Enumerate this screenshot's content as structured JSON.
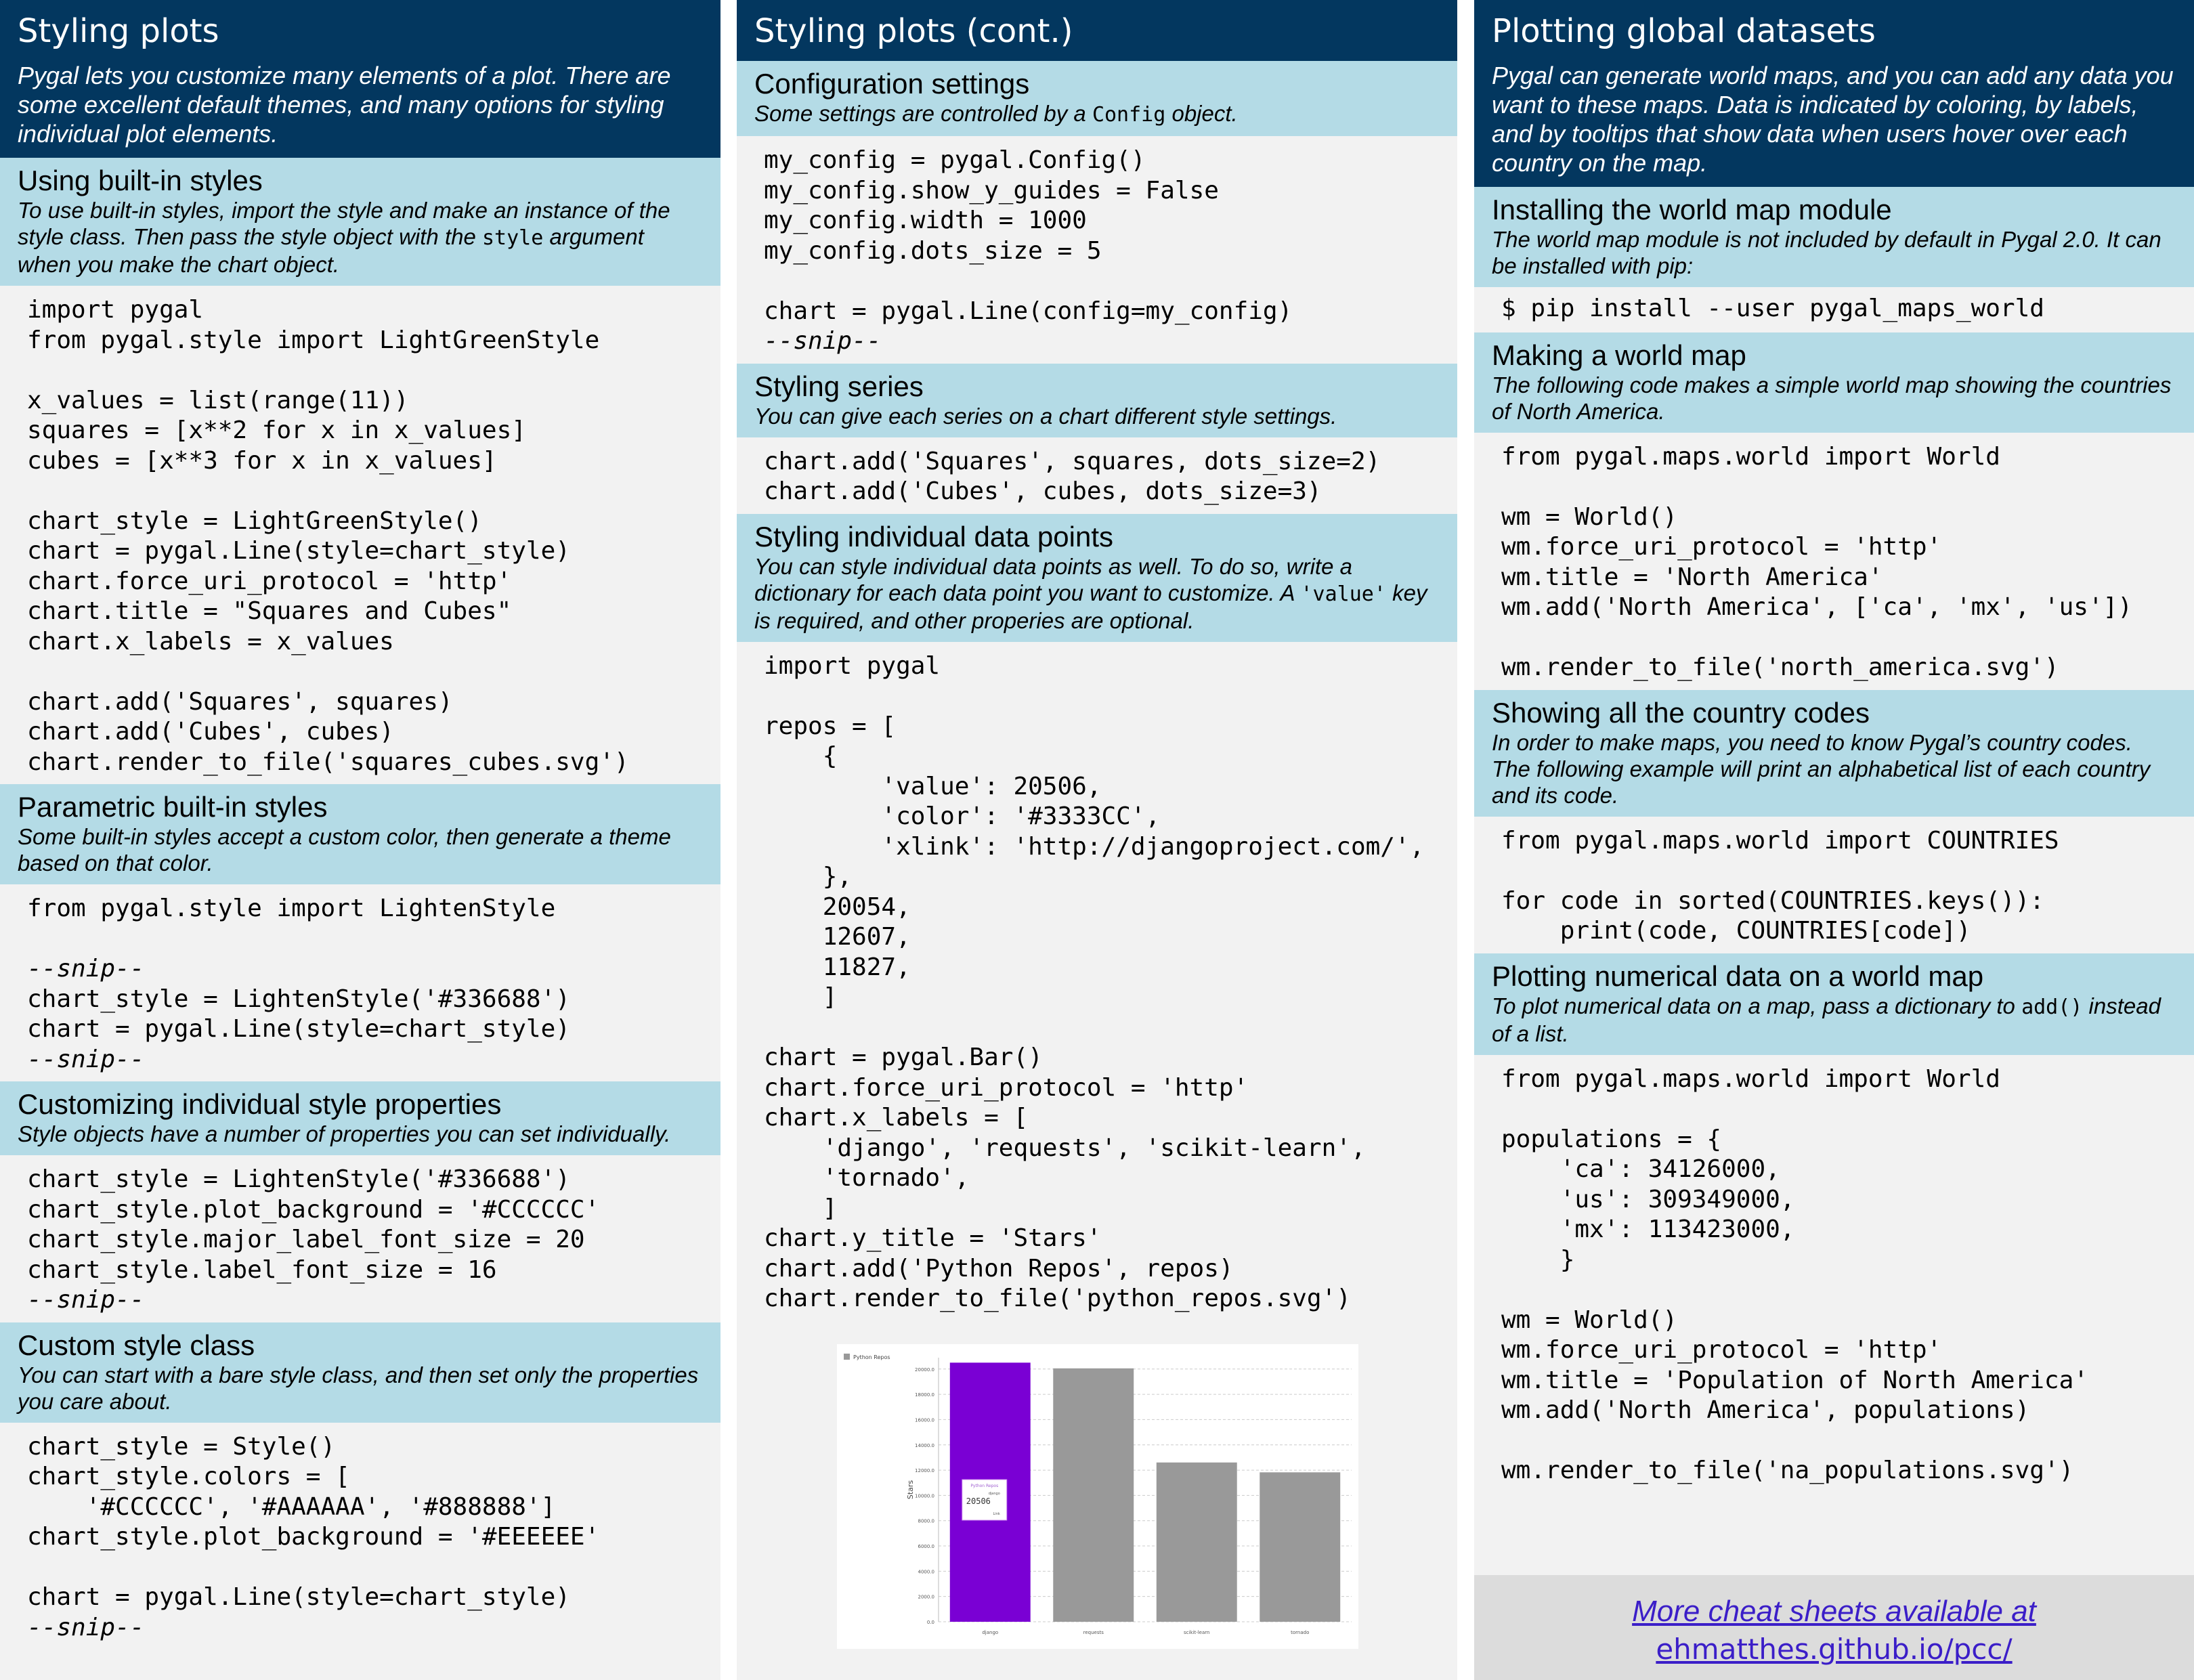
{
  "col1": {
    "header": {
      "title": "Styling plots",
      "intro": "Pygal lets you customize many elements of a plot. There are some excellent default themes, and many options for styling individual plot elements."
    },
    "builtin": {
      "title": "Using built-in styles",
      "desc_pre": "To use built-in styles, import the style and make an instance of the style class. Then pass the style object with the ",
      "desc_code": "style",
      "desc_post": " argument when you make the chart object.",
      "code": "import pygal\nfrom pygal.style import LightGreenStyle\n\nx_values = list(range(11))\nsquares = [x**2 for x in x_values]\ncubes = [x**3 for x in x_values]\n\nchart_style = LightGreenStyle()\nchart = pygal.Line(style=chart_style)\nchart.force_uri_protocol = 'http'\nchart.title = \"Squares and Cubes\"\nchart.x_labels = x_values\n\nchart.add('Squares', squares)\nchart.add('Cubes', cubes)\nchart.render_to_file('squares_cubes.svg')"
    },
    "parametric": {
      "title": "Parametric built-in styles",
      "desc": "Some built-in styles accept a custom color, then generate a theme based on that color.",
      "code_pre": "from pygal.style import LightenStyle\n\n",
      "snip": "--snip--",
      "code_mid": "\nchart_style = LightenStyle('#336688')\nchart = pygal.Line(style=chart_style)\n"
    },
    "customizing": {
      "title": "Customizing individual style properties",
      "desc": "Style objects have a number of properties you can set individually.",
      "code": "chart_style = LightenStyle('#336688')\nchart_style.plot_background = '#CCCCCC'\nchart_style.major_label_font_size = 20\nchart_style.label_font_size = 16\n"
    },
    "custom_class": {
      "title": "Custom style class",
      "desc": "You can start with a bare style class, and then set only the properties you care about.",
      "code": "chart_style = Style()\nchart_style.colors = [\n    '#CCCCCC', '#AAAAAA', '#888888']\nchart_style.plot_background = '#EEEEEE'\n\nchart = pygal.Line(style=chart_style)\n"
    }
  },
  "col2": {
    "header": {
      "title": "Styling plots (cont.)"
    },
    "config": {
      "title": "Configuration settings",
      "desc_pre": "Some settings are controlled by a ",
      "desc_code": "Config",
      "desc_post": " object.",
      "code": "my_config = pygal.Config()\nmy_config.show_y_guides = False\nmy_config.width = 1000\nmy_config.dots_size = 5\n\nchart = pygal.Line(config=my_config)\n"
    },
    "series": {
      "title": "Styling series",
      "desc": "You can give each series on a chart different style settings.",
      "code": "chart.add('Squares', squares, dots_size=2)\nchart.add('Cubes', cubes, dots_size=3)"
    },
    "points": {
      "title": "Styling individual data points",
      "desc_pre": "You can style individual data points as well. To do so, write a dictionary for each data point you want to customize. A ",
      "desc_code": "'value'",
      "desc_post": " key is required, and other properies are optional.",
      "code": "import pygal\n\nrepos = [\n    {\n        'value': 20506,\n        'color': '#3333CC',\n        'xlink': 'http://djangoproject.com/',\n    },\n    20054,\n    12607,\n    11827,\n    ]\n\nchart = pygal.Bar()\nchart.force_uri_protocol = 'http'\nchart.x_labels = [\n    'django', 'requests', 'scikit-learn',\n    'tornado',\n    ]\nchart.y_title = 'Stars'\nchart.add('Python Repos', repos)\nchart.render_to_file('python_repos.svg')"
    }
  },
  "col3": {
    "header": {
      "title": "Plotting global datasets",
      "intro": "Pygal can generate world maps, and you can add any data you want to these maps. Data is indicated by coloring, by labels, and by tooltips that show data when users hover over each country on the map."
    },
    "install": {
      "title": "Installing the world map module",
      "desc": "The world map module is not included by default in Pygal 2.0. It can be installed with pip:",
      "code": "$ pip install --user pygal_maps_world"
    },
    "world_map": {
      "title": "Making a world map",
      "desc": "The following code makes a simple world map showing the countries of North America.",
      "code": "from pygal.maps.world import World\n\nwm = World()\nwm.force_uri_protocol = 'http'\nwm.title = 'North America'\nwm.add('North America', ['ca', 'mx', 'us'])\n\nwm.render_to_file('north_america.svg')"
    },
    "codes": {
      "title": "Showing all the country codes",
      "desc": "In order to make maps, you need to know Pygal’s country codes. The following example will print an alphabetical list of each country and its code.",
      "code": "from pygal.maps.world import COUNTRIES\n\nfor code in sorted(COUNTRIES.keys()):\n    print(code, COUNTRIES[code])"
    },
    "numerical": {
      "title": "Plotting numerical data on a world map",
      "desc_pre": "To plot numerical data on a map, pass a dictionary to ",
      "desc_code": "add()",
      "desc_post": " instead of a list.",
      "code": "from pygal.maps.world import World\n\npopulations = {\n    'ca': 34126000,\n    'us': 309349000,\n    'mx': 113423000,\n    }\n\nwm = World()\nwm.force_uri_protocol = 'http'\nwm.title = 'Population of North America'\nwm.add('North America', populations)\n\nwm.render_to_file('na_populations.svg')"
    }
  },
  "footer": {
    "line1": "More cheat sheets available at",
    "line2": "ehmatthes.github.io/pcc/"
  },
  "chart_data": {
    "type": "bar",
    "categories": [
      "django",
      "requests",
      "scikit-learn",
      "tornado"
    ],
    "series": [
      {
        "name": "Python Repos",
        "values": [
          20506,
          20054,
          12607,
          11827
        ]
      }
    ],
    "colors": [
      "#7a00d4",
      "#999999",
      "#999999",
      "#999999"
    ],
    "ylabel": "Stars",
    "ylim": [
      0,
      20000
    ],
    "yticks": [
      "0.0",
      "2000.0",
      "4000.0",
      "6000.0",
      "8000.0",
      "10000.0",
      "12000.0",
      "14000.0",
      "16000.0",
      "18000.0",
      "20000.0"
    ],
    "tooltip": {
      "title": "Python Repos",
      "category": "django",
      "value": "20506",
      "link": "Link"
    },
    "legend": "top-left"
  }
}
